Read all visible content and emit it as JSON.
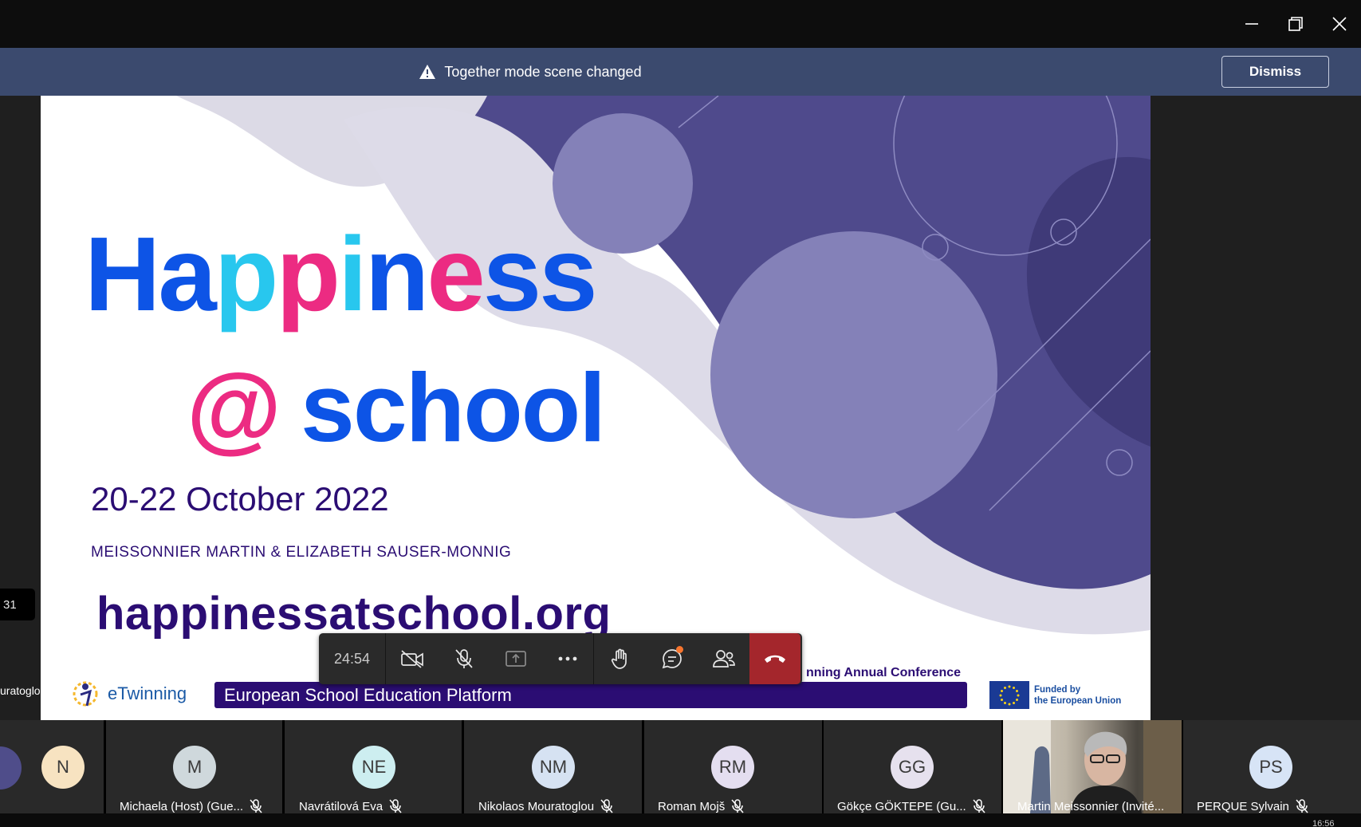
{
  "banner": {
    "message": "Together mode scene changed",
    "dismiss_label": "Dismiss"
  },
  "window_controls": [
    "minimize-icon",
    "restore-icon",
    "close-icon"
  ],
  "stage": {
    "left_chip_text": "31",
    "left_partial_name": "uratoglou"
  },
  "slide": {
    "title_letters": [
      {
        "ch": "H",
        "color": "b"
      },
      {
        "ch": "a",
        "color": "b"
      },
      {
        "ch": "p",
        "color": "c"
      },
      {
        "ch": "p",
        "color": "p"
      },
      {
        "ch": "i",
        "color": "c"
      },
      {
        "ch": "n",
        "color": "b"
      },
      {
        "ch": "e",
        "color": "p"
      },
      {
        "ch": "s",
        "color": "b"
      },
      {
        "ch": "s",
        "color": "b"
      }
    ],
    "subtitle_at": "@",
    "subtitle_word": "school",
    "date": "20-22 October 2022",
    "authors": "MEISSONNIER MARTIN & ELIZABETH SAUSER-MONNIG",
    "url": "happinessatschool.org",
    "conference_partial": "nning Annual Conference",
    "etwinning_logo": "eTwinning",
    "platform_label": "European School Education Platform",
    "eu_label_line1": "Funded by",
    "eu_label_line2": "the European Union"
  },
  "controls": {
    "timer": "24:54",
    "buttons": [
      {
        "name": "camera-off-button",
        "icon": "camera-off-icon"
      },
      {
        "name": "mic-off-button",
        "icon": "mic-off-icon"
      },
      {
        "name": "share-screen-button",
        "icon": "share-icon"
      },
      {
        "name": "more-actions-button",
        "icon": "more-icon"
      },
      {
        "name": "raise-hand-button",
        "icon": "hand-icon"
      },
      {
        "name": "chat-button",
        "icon": "chat-icon"
      },
      {
        "name": "participants-button",
        "icon": "people-icon"
      }
    ],
    "leave_icon": "hang-up-icon"
  },
  "participants": [
    {
      "initials": "N",
      "name": "",
      "avatar_color": "#f7e3c1"
    },
    {
      "initials": "M",
      "name": "Michaela (Host) (Gue...",
      "avatar_color": "#cfd8dc"
    },
    {
      "initials": "NE",
      "name": "Navrátilová Eva",
      "avatar_color": "#cdeef0"
    },
    {
      "initials": "NM",
      "name": "Nikolaos Mouratoglou",
      "avatar_color": "#d6e2f2"
    },
    {
      "initials": "RM",
      "name": "Roman Mojš",
      "avatar_color": "#e4def0"
    },
    {
      "initials": "GG",
      "name": "Gökçe GÖKTEPE (Gu...",
      "avatar_color": "#e6e1ee"
    },
    {
      "initials": "",
      "name": "Martin Meissonnier (Invité...",
      "avatar_color": ""
    },
    {
      "initials": "PS",
      "name": "PERQUE Sylvain",
      "avatar_color": "#d7e4f6"
    }
  ],
  "clock": "16:56"
}
